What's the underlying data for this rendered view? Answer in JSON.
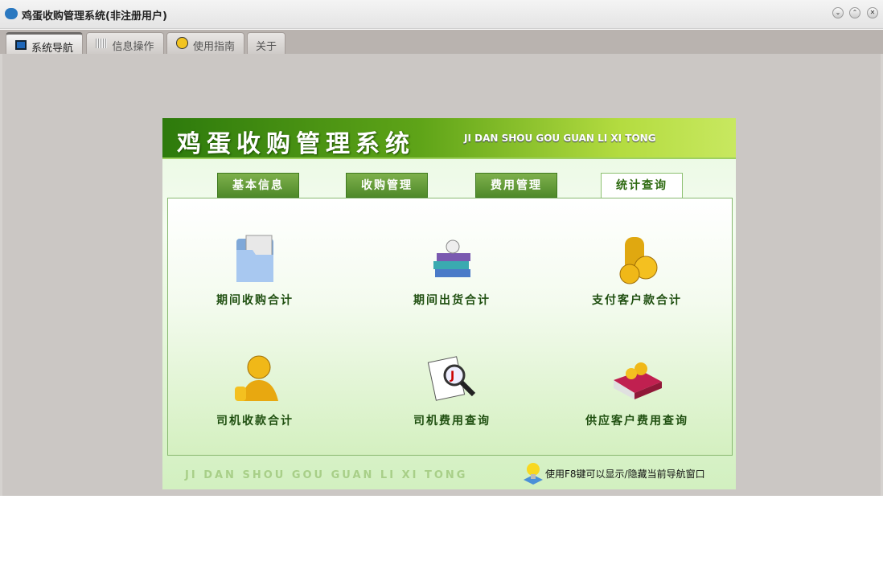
{
  "window": {
    "title": "鸡蛋收购管理系统(非注册用户)",
    "controls": [
      "minimize",
      "maximize",
      "close"
    ]
  },
  "tabs": [
    {
      "label": "系统导航",
      "icon": "monitor-icon"
    },
    {
      "label": "信息操作",
      "icon": "grid-icon"
    },
    {
      "label": "使用指南",
      "icon": "help-icon"
    },
    {
      "label": "关于"
    }
  ],
  "banner": {
    "title": "鸡蛋收购管理系统",
    "subtitle": "JI DAN SHOU GOU GUAN LI XI TONG"
  },
  "menu_tabs": [
    "基本信息",
    "收购管理",
    "费用管理",
    "统计查询"
  ],
  "active_menu_tab": "统计查询",
  "items": [
    {
      "label": "期间收购合计",
      "icon": "folder-icon"
    },
    {
      "label": "期间出货合计",
      "icon": "books-icon"
    },
    {
      "label": "支付客户款合计",
      "icon": "coins-icon"
    },
    {
      "label": "司机收款合计",
      "icon": "money-person-icon"
    },
    {
      "label": "司机费用查询",
      "icon": "document-search-icon"
    },
    {
      "label": "供应客户费用查询",
      "icon": "book-coins-icon"
    }
  ],
  "footer": {
    "subtitle": "JI DAN SHOU GOU GUAN LI XI TONG",
    "tip": "使用F8键可以显示/隐藏当前导航窗口"
  }
}
